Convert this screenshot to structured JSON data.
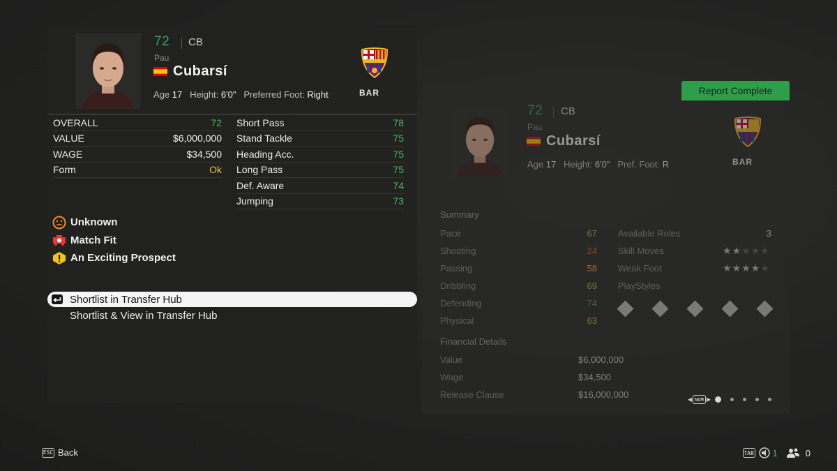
{
  "player": {
    "rating": "72",
    "position": "CB",
    "first_name": "Pau",
    "last_name": "Cubarsí",
    "age_label": "Age",
    "age": "17",
    "height_label": "Height:",
    "height": "6'0\"",
    "foot_label": "Preferred Foot:",
    "foot": "Right",
    "club": "BAR"
  },
  "left_stats": [
    {
      "label": "OVERALL",
      "value": "72",
      "color": "green"
    },
    {
      "label": "VALUE",
      "value": "$6,000,000",
      "color": "white"
    },
    {
      "label": "WAGE",
      "value": "$34,500",
      "color": "white"
    },
    {
      "label": "Form",
      "value": "Ok",
      "color": "yellow"
    }
  ],
  "attr_stats": [
    {
      "label": "Short Pass",
      "value": "78"
    },
    {
      "label": "Stand Tackle",
      "value": "75"
    },
    {
      "label": "Heading Acc.",
      "value": "75"
    },
    {
      "label": "Long Pass",
      "value": "75"
    },
    {
      "label": "Def. Aware",
      "value": "74"
    },
    {
      "label": "Jumping",
      "value": "73"
    }
  ],
  "status": [
    {
      "label": "Unknown",
      "icon": "neutral-face-icon"
    },
    {
      "label": "Match Fit",
      "icon": "fitness-icon"
    },
    {
      "label": "An Exciting Prospect",
      "icon": "warning-icon"
    }
  ],
  "menu": [
    {
      "label": "Shortlist in Transfer Hub",
      "selected": true
    },
    {
      "label": "Shortlist & View in Transfer Hub",
      "selected": false
    }
  ],
  "report": {
    "button": "Report Complete",
    "rating": "72",
    "position": "CB",
    "first_name": "Pau",
    "last_name": "Cubarsí",
    "age_label": "Age",
    "age": "17",
    "height_label": "Height:",
    "height": "6'0\"",
    "foot_label": "Pref. Foot:",
    "foot": "R",
    "club": "BAR",
    "summary_title": "Summary",
    "summary": [
      {
        "label": "Pace",
        "value": "67",
        "color": "#8bbf3e"
      },
      {
        "label": "Shooting",
        "value": "24",
        "color": "#d9602a"
      },
      {
        "label": "Passing",
        "value": "58",
        "color": "#e0a630"
      },
      {
        "label": "Dribbling",
        "value": "69",
        "color": "#9bc03c"
      },
      {
        "label": "Defending",
        "value": "74",
        "color": "#3aa571"
      },
      {
        "label": "Physical",
        "value": "63",
        "color": "#b8b832"
      }
    ],
    "roles_label": "Available Roles",
    "roles_value": "3",
    "skill_label": "Skill Moves",
    "skill_stars": 2,
    "weak_label": "Weak Foot",
    "weak_stars": 4,
    "playstyles_label": "PlayStyles",
    "financial_title": "Financial Details",
    "financial": [
      {
        "label": "Value",
        "value": "$6,000,000"
      },
      {
        "label": "Wage",
        "value": "$34,500"
      },
      {
        "label": "Release Clause",
        "value": "$16,000,000"
      }
    ],
    "page_key": "NUM"
  },
  "footer": {
    "back_key": "ESC",
    "back_label": "Back",
    "tab_key": "TAB",
    "count_a": "1",
    "count_b": "0"
  },
  "colors": {
    "accent_green": "#2f9e4b",
    "stat_green": "#4cb860",
    "form_yellow": "#e9c53a"
  }
}
